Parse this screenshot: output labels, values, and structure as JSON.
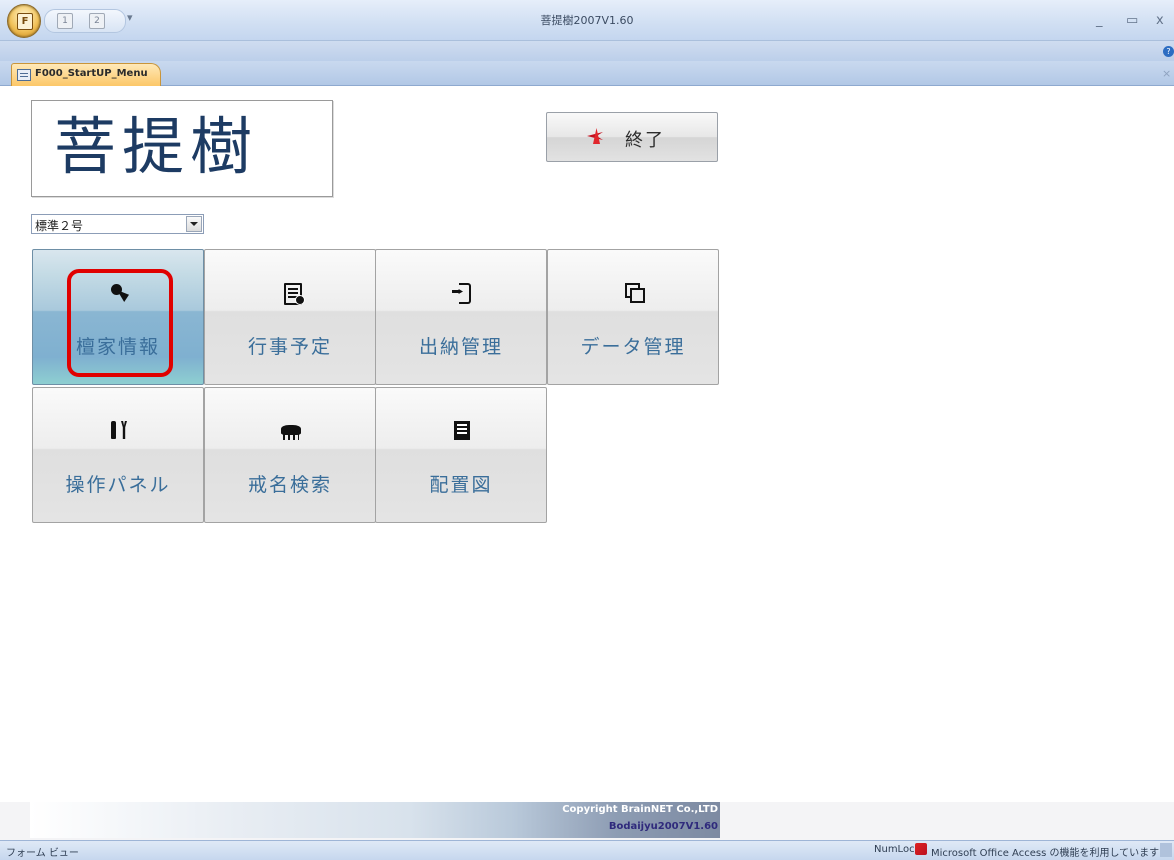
{
  "window": {
    "title": "菩提樹2007V1.60",
    "office_button_letter": "F",
    "qat_icon_1": "1",
    "qat_icon_2": "2",
    "qat_dropdown": "▾",
    "minimize": "_",
    "maximize": "▭",
    "close": "x",
    "help": "?"
  },
  "tab": {
    "label": "F000_StartUP_Menu",
    "close": "×"
  },
  "form": {
    "logo_text": "菩提樹",
    "exit_label": "終了",
    "combo_value": "標準２号",
    "tiles": [
      {
        "label": "檀家情報",
        "icon": "pin-pen-icon",
        "selected": true
      },
      {
        "label": "行事予定",
        "icon": "schedule-book-icon",
        "selected": false
      },
      {
        "label": "出納管理",
        "icon": "sign-in-icon",
        "selected": false
      },
      {
        "label": "データ管理",
        "icon": "copy-icon",
        "selected": false
      },
      {
        "label": "操作パネル",
        "icon": "tools-icon",
        "selected": false
      },
      {
        "label": "戒名検索",
        "icon": "camel-icon",
        "selected": false
      },
      {
        "label": "配置図",
        "icon": "document-icon",
        "selected": false
      }
    ]
  },
  "footer": {
    "copyright": "Copyright  BrainNET Co.,LTD",
    "version": "Bodaijyu2007V1.60"
  },
  "statusbar": {
    "view": "フォーム ビュー",
    "numlock": "NumLock",
    "access_message": "Microsoft Office Access の機能を利用しています"
  },
  "colors": {
    "highlight": "#e00000",
    "tile_label": "#3a6e9a",
    "logo_ink": "#1d3b63"
  }
}
